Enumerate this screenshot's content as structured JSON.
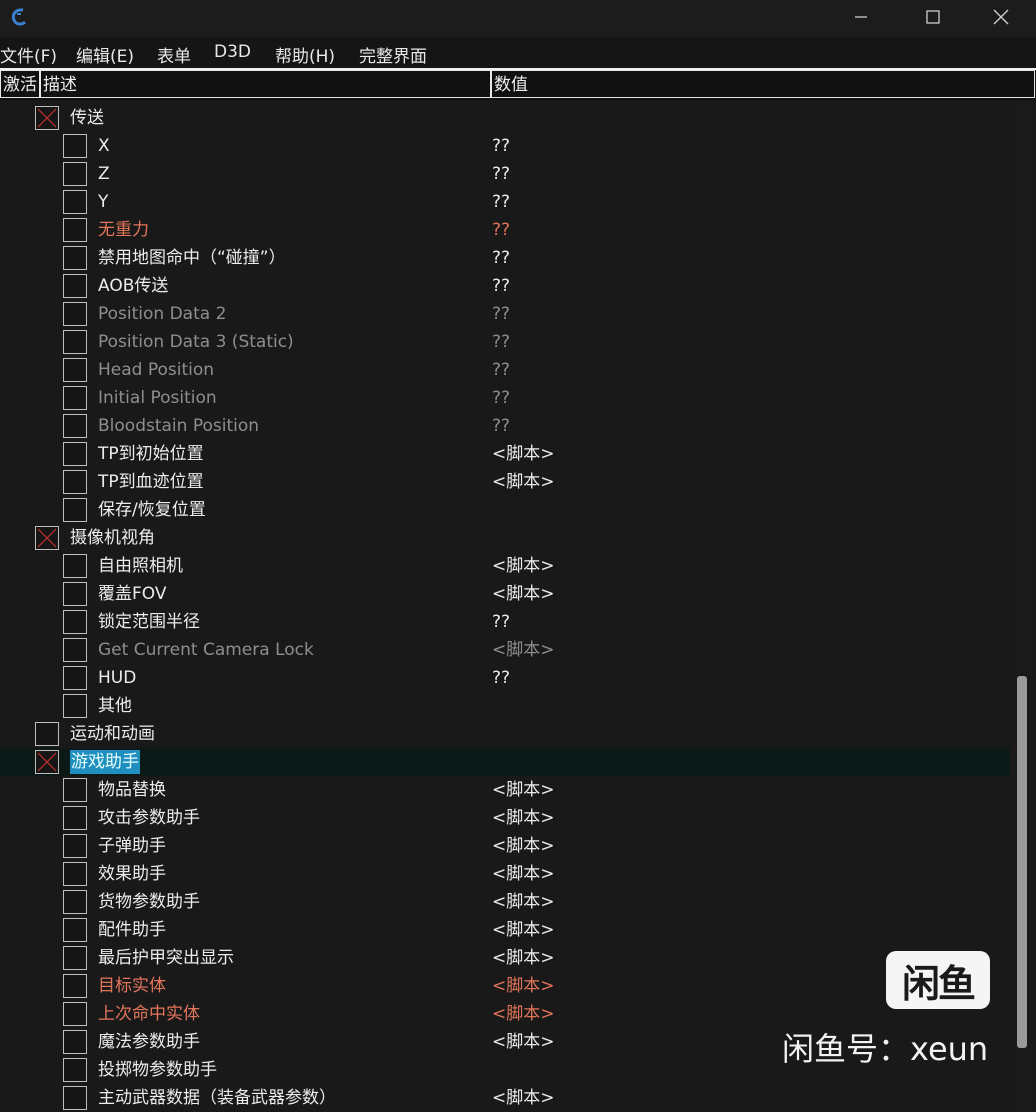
{
  "titlebar": {
    "icons": [
      "app-logo-icon",
      "minimize-icon",
      "maximize-icon",
      "close-icon"
    ]
  },
  "menu": [
    "文件(F)",
    "编辑(E)",
    "表单",
    "D3D",
    "帮助(H)",
    "完整界面"
  ],
  "headers": {
    "active": "激活",
    "description": "描述",
    "value": "数值"
  },
  "rows": [
    {
      "d": "传送",
      "v": "",
      "level": 0,
      "x": true,
      "c": ""
    },
    {
      "d": "X",
      "v": "??",
      "level": 1,
      "x": false,
      "c": ""
    },
    {
      "d": "Z",
      "v": "??",
      "level": 1,
      "x": false,
      "c": ""
    },
    {
      "d": "Y",
      "v": "??",
      "level": 1,
      "x": false,
      "c": ""
    },
    {
      "d": "无重力",
      "v": "??",
      "level": 1,
      "x": false,
      "c": "red"
    },
    {
      "d": "禁用地图命中（“碰撞”）",
      "v": "??",
      "level": 1,
      "x": false,
      "c": ""
    },
    {
      "d": "AOB传送",
      "v": "??",
      "level": 1,
      "x": false,
      "c": ""
    },
    {
      "d": "Position Data 2",
      "v": "??",
      "level": 1,
      "x": false,
      "c": "gray"
    },
    {
      "d": "Position Data 3 (Static)",
      "v": "??",
      "level": 1,
      "x": false,
      "c": "gray"
    },
    {
      "d": "Head Position",
      "v": "??",
      "level": 1,
      "x": false,
      "c": "gray"
    },
    {
      "d": "Initial Position",
      "v": "??",
      "level": 1,
      "x": false,
      "c": "gray"
    },
    {
      "d": "Bloodstain Position",
      "v": "??",
      "level": 1,
      "x": false,
      "c": "gray"
    },
    {
      "d": "TP到初始位置",
      "v": "<脚本>",
      "level": 1,
      "x": false,
      "c": ""
    },
    {
      "d": "TP到血迹位置",
      "v": "<脚本>",
      "level": 1,
      "x": false,
      "c": ""
    },
    {
      "d": "保存/恢复位置",
      "v": "",
      "level": 1,
      "x": false,
      "c": ""
    },
    {
      "d": "摄像机视角",
      "v": "",
      "level": 0,
      "x": true,
      "c": ""
    },
    {
      "d": "自由照相机",
      "v": "<脚本>",
      "level": 1,
      "x": false,
      "c": ""
    },
    {
      "d": "覆盖FOV",
      "v": "<脚本>",
      "level": 1,
      "x": false,
      "c": ""
    },
    {
      "d": "锁定范围半径",
      "v": "??",
      "level": 1,
      "x": false,
      "c": ""
    },
    {
      "d": "Get Current Camera Lock",
      "v": "<脚本>",
      "level": 1,
      "x": false,
      "c": "gray"
    },
    {
      "d": "HUD",
      "v": "??",
      "level": 1,
      "x": false,
      "c": ""
    },
    {
      "d": "其他",
      "v": "",
      "level": 1,
      "x": false,
      "c": ""
    },
    {
      "d": "运动和动画",
      "v": "",
      "level": 0,
      "x": false,
      "c": ""
    },
    {
      "d": "游戏助手",
      "v": "",
      "level": 0,
      "x": true,
      "c": "",
      "selected": true
    },
    {
      "d": "物品替换",
      "v": "<脚本>",
      "level": 1,
      "x": false,
      "c": ""
    },
    {
      "d": "攻击参数助手",
      "v": "<脚本>",
      "level": 1,
      "x": false,
      "c": ""
    },
    {
      "d": "子弹助手",
      "v": "<脚本>",
      "level": 1,
      "x": false,
      "c": ""
    },
    {
      "d": "效果助手",
      "v": "<脚本>",
      "level": 1,
      "x": false,
      "c": ""
    },
    {
      "d": "货物参数助手",
      "v": "<脚本>",
      "level": 1,
      "x": false,
      "c": ""
    },
    {
      "d": "配件助手",
      "v": "<脚本>",
      "level": 1,
      "x": false,
      "c": ""
    },
    {
      "d": "最后护甲突出显示",
      "v": "<脚本>",
      "level": 1,
      "x": false,
      "c": ""
    },
    {
      "d": "目标实体",
      "v": "<脚本>",
      "level": 1,
      "x": false,
      "c": "red"
    },
    {
      "d": "上次命中实体",
      "v": "<脚本>",
      "level": 1,
      "x": false,
      "c": "red"
    },
    {
      "d": "魔法参数助手",
      "v": "<脚本>",
      "level": 1,
      "x": false,
      "c": ""
    },
    {
      "d": "投掷物参数助手",
      "v": "",
      "level": 1,
      "x": false,
      "c": ""
    },
    {
      "d": "主动武器数据（装备武器参数）",
      "v": "<脚本>",
      "level": 1,
      "x": false,
      "c": ""
    }
  ],
  "watermark": {
    "logo": "闲鱼",
    "text": "闲鱼号：xeun"
  },
  "colors": {
    "accent_red": "#e3755a",
    "disabled_gray": "#8e8e8e",
    "selection": "#1e8fbf"
  }
}
